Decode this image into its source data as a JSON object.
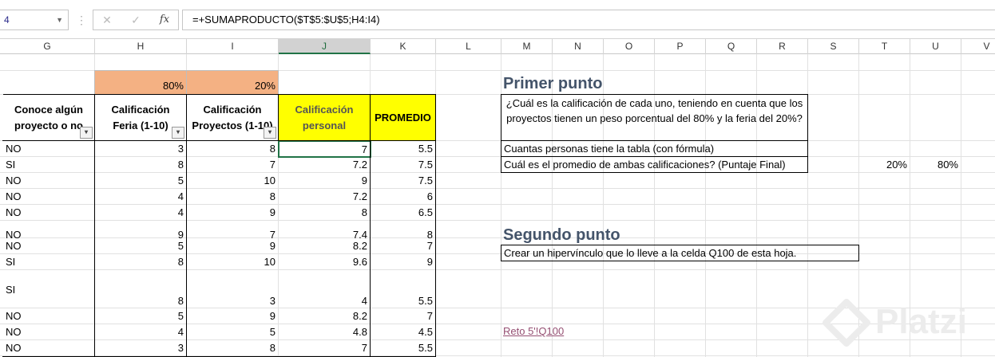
{
  "formula_bar": {
    "name_box": "4",
    "cancel_icon": "✕",
    "enter_icon": "✓",
    "fx_label": "fx",
    "formula": "=+SUMAPRODUCTO($T$5:$U$5;H4:I4)"
  },
  "columns": [
    "G",
    "H",
    "I",
    "J",
    "K",
    "L",
    "M",
    "N",
    "O",
    "P",
    "Q",
    "R",
    "S",
    "T",
    "U",
    "V"
  ],
  "selected_column": "J",
  "percent_row": {
    "H": "80%",
    "I": "20%"
  },
  "table": {
    "headers": {
      "G": "Conoce algún proyecto o no",
      "H": "Calificación Feria (1-10)",
      "I": "Calificación Proyectos (1-10)",
      "J": "Calificación personal",
      "K": "PROMEDIO"
    },
    "rows": [
      {
        "g": "NO",
        "h": "3",
        "i": "8",
        "j": "7",
        "k": "5.5"
      },
      {
        "g": "SI",
        "h": "8",
        "i": "7",
        "j": "7.2",
        "k": "7.5"
      },
      {
        "g": "NO",
        "h": "5",
        "i": "10",
        "j": "9",
        "k": "7.5"
      },
      {
        "g": "NO",
        "h": "4",
        "i": "8",
        "j": "7.2",
        "k": "6"
      },
      {
        "g": "NO",
        "h": "4",
        "i": "9",
        "j": "8",
        "k": "6.5"
      },
      {
        "g": "NO",
        "h": "9",
        "i": "7",
        "j": "7.4",
        "k": "8"
      },
      {
        "g": "NO",
        "h": "5",
        "i": "9",
        "j": "8.2",
        "k": "7"
      },
      {
        "g": "SI",
        "h": "8",
        "i": "10",
        "j": "9.6",
        "k": "9"
      },
      {
        "g": "SI",
        "h": "8",
        "i": "3",
        "j": "4",
        "k": "5.5"
      },
      {
        "g": "NO",
        "h": "5",
        "i": "9",
        "j": "8.2",
        "k": "7"
      },
      {
        "g": "NO",
        "h": "4",
        "i": "5",
        "j": "4.8",
        "k": "4.5"
      },
      {
        "g": "NO",
        "h": "3",
        "i": "8",
        "j": "7",
        "k": "5.5"
      }
    ]
  },
  "primer_punto": {
    "title": "Primer punto",
    "question1": "¿Cuál es la calificación de cada uno, teniendo en cuenta que los proyectos tienen un peso porcentual del 80% y la feria del 20%?",
    "question2": "Cuantas personas tiene la tabla (con fórmula)",
    "question3": "Cuál es el promedio de ambas calificaciones? (Puntaje Final)",
    "t_value": "20%",
    "u_value": "80%"
  },
  "segundo_punto": {
    "title": "Segundo punto",
    "question": "Crear un hipervínculo que lo lleve a la celda Q100 de esta hoja.",
    "link_text": "Reto 5'!Q100"
  },
  "watermark": "Platzi",
  "colors": {
    "orange": "#f4b183",
    "yellow": "#ffff00",
    "excel_green": "#217346"
  }
}
